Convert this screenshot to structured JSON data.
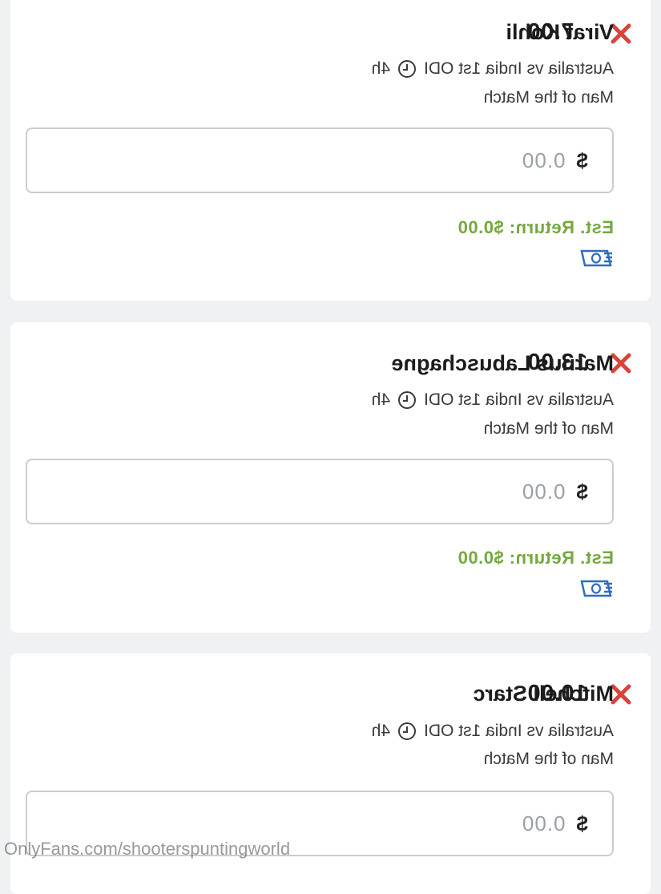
{
  "colors": {
    "accent_return": "#74a83f",
    "remove_red": "#d9443a",
    "cash_icon_blue": "#2f6dbf"
  },
  "icons": {
    "remove": "close-x-icon",
    "clock": "clock-icon",
    "cash": "cash-icon",
    "currency": "dollar-sign"
  },
  "bets": [
    {
      "selection": "Virat Kohli",
      "odds": "7.00",
      "event": "Australia vs India 1st ODI",
      "time": "4h",
      "market": "Man of the Match",
      "currency_symbol": "$",
      "stake_placeholder": "0.00",
      "est_return": "Est. Return: $0.00"
    },
    {
      "selection": "Marnus Labuschagne",
      "odds": "13.00",
      "event": "Australia vs India 1st ODI",
      "time": "4h",
      "market": "Man of the Match",
      "currency_symbol": "$",
      "stake_placeholder": "0.00",
      "est_return": "Est. Return: $0.00"
    },
    {
      "selection": "Mitchell Starc",
      "odds": "10.00",
      "event": "Australia vs India 1st ODI",
      "time": "4h",
      "market": "Man of the Match",
      "currency_symbol": "$",
      "stake_placeholder": "0.00"
    }
  ],
  "watermark": "OnlyFans.com/shooterspuntingworld"
}
